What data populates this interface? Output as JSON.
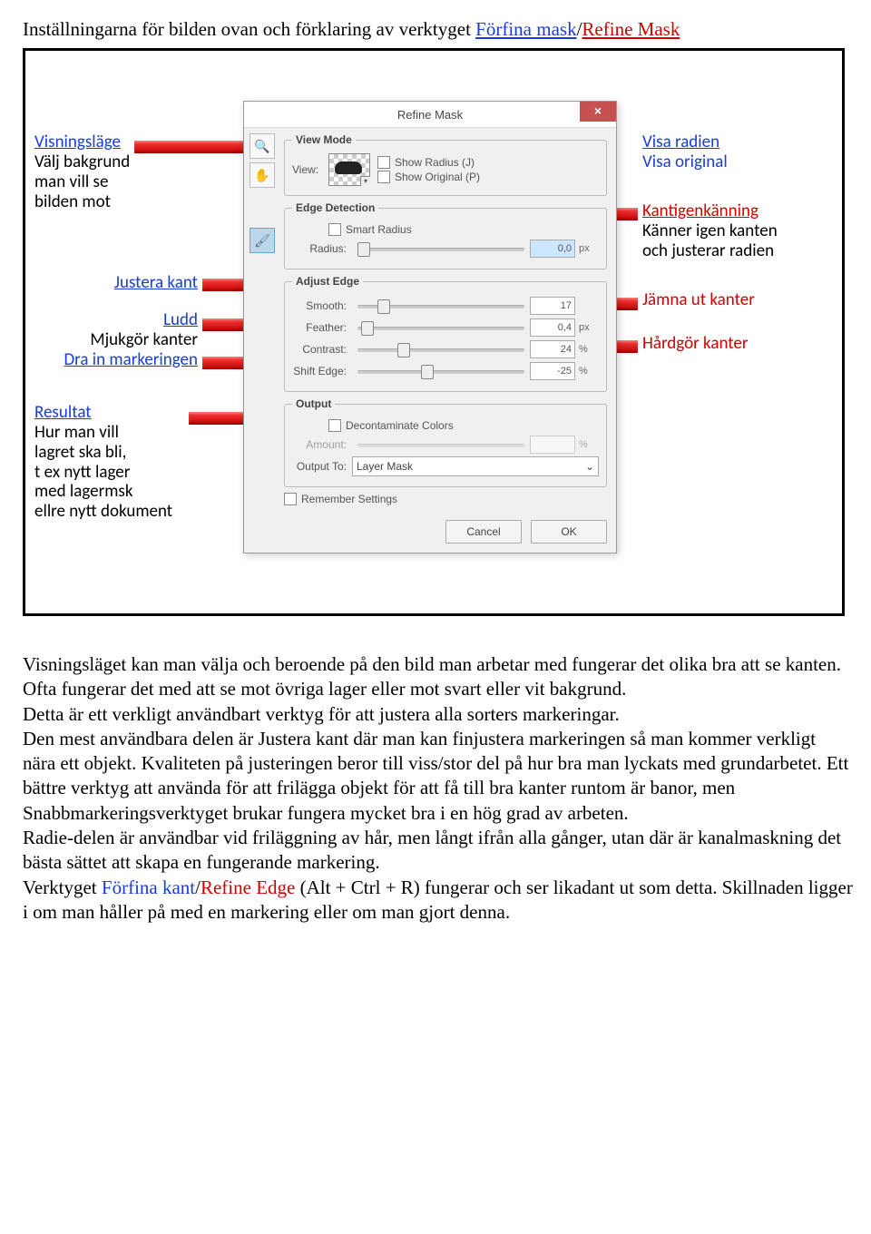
{
  "heading_prefix": "Inställningarna för bilden ovan och förklaring av verktyget ",
  "heading_blue": "Förfina mask",
  "heading_slash": "/",
  "heading_red": "Refine Mask",
  "dialog": {
    "title": "Refine Mask",
    "close": "×",
    "viewmode_legend": "View Mode",
    "view_label": "View:",
    "show_radius": "Show Radius (J)",
    "show_original": "Show Original (P)",
    "edge_legend": "Edge Detection",
    "smart_radius": "Smart Radius",
    "radius_label": "Radius:",
    "radius_value": "0,0",
    "radius_unit": "px",
    "adjust_legend": "Adjust Edge",
    "smooth_label": "Smooth:",
    "smooth_value": "17",
    "feather_label": "Feather:",
    "feather_value": "0,4",
    "feather_unit": "px",
    "contrast_label": "Contrast:",
    "contrast_value": "24",
    "contrast_unit": "%",
    "shift_label": "Shift Edge:",
    "shift_value": "-25",
    "shift_unit": "%",
    "output_legend": "Output",
    "decon": "Decontaminate Colors",
    "amount_label": "Amount:",
    "amount_unit": "%",
    "outputto_label": "Output To:",
    "outputto_value": "Layer Mask",
    "remember": "Remember Settings",
    "cancel": "Cancel",
    "ok": "OK"
  },
  "ann": {
    "visning_title": "Visningsläge",
    "visning_line1": "Välj bakgrund",
    "visning_line2": "man vill se",
    "visning_line3": "bilden mot",
    "justera_title": "Justera kant",
    "ludd_title": "Ludd",
    "ludd_line1": "Mjukgör kanter",
    "drain": "Dra in markeringen",
    "resultat_title": "Resultat",
    "resultat_l1": "Hur man vill",
    "resultat_l2": "lagret ska bli,",
    "resultat_l3": "t ex nytt lager",
    "resultat_l4": "med lagermsk",
    "resultat_l5": "ellre nytt dokument",
    "visaradien": "Visa radien",
    "visaorig": "Visa original",
    "kant_title": "Kantigenkänning",
    "kant_l1": "Känner igen kanten",
    "kant_l2": "och justerar radien",
    "jamna": "Jämna ut kanter",
    "hardgor": "Hårdgör kanter"
  },
  "body": {
    "p1": "Visningsläget kan man välja och beroende på den bild man arbetar med fungerar det olika bra att se kanten. Ofta fungerar det med att se mot övriga lager eller mot svart eller vit bakgrund.",
    "p2": "Detta är ett verkligt användbart verktyg för att justera alla sorters markeringar.",
    "p3": "Den mest användbara delen är Justera kant där man kan finjustera markeringen så man kommer verkligt nära ett objekt. Kvaliteten på justeringen beror till viss/stor del på hur bra man lyckats med grundarbetet.  Ett bättre verktyg att använda för att frilägga objekt för att få till bra kanter runtom är banor, men Snabbmarkeringsverktyget brukar fungera mycket bra i en hög grad av arbeten.",
    "p4": "Radie-delen är användbar vid friläggning av hår, men långt ifrån alla gånger, utan där är kanalmaskning det bästa sättet att skapa en fungerande markering.",
    "p5a": "Verktyget ",
    "p5_blue": "Förfina kant",
    "p5_slash": "/",
    "p5_red": "Refine Edge",
    "p5b": " (Alt + Ctrl + R) fungerar och ser likadant ut som detta. Skillnaden ligger i om man håller på med en markering eller om man gjort denna."
  }
}
